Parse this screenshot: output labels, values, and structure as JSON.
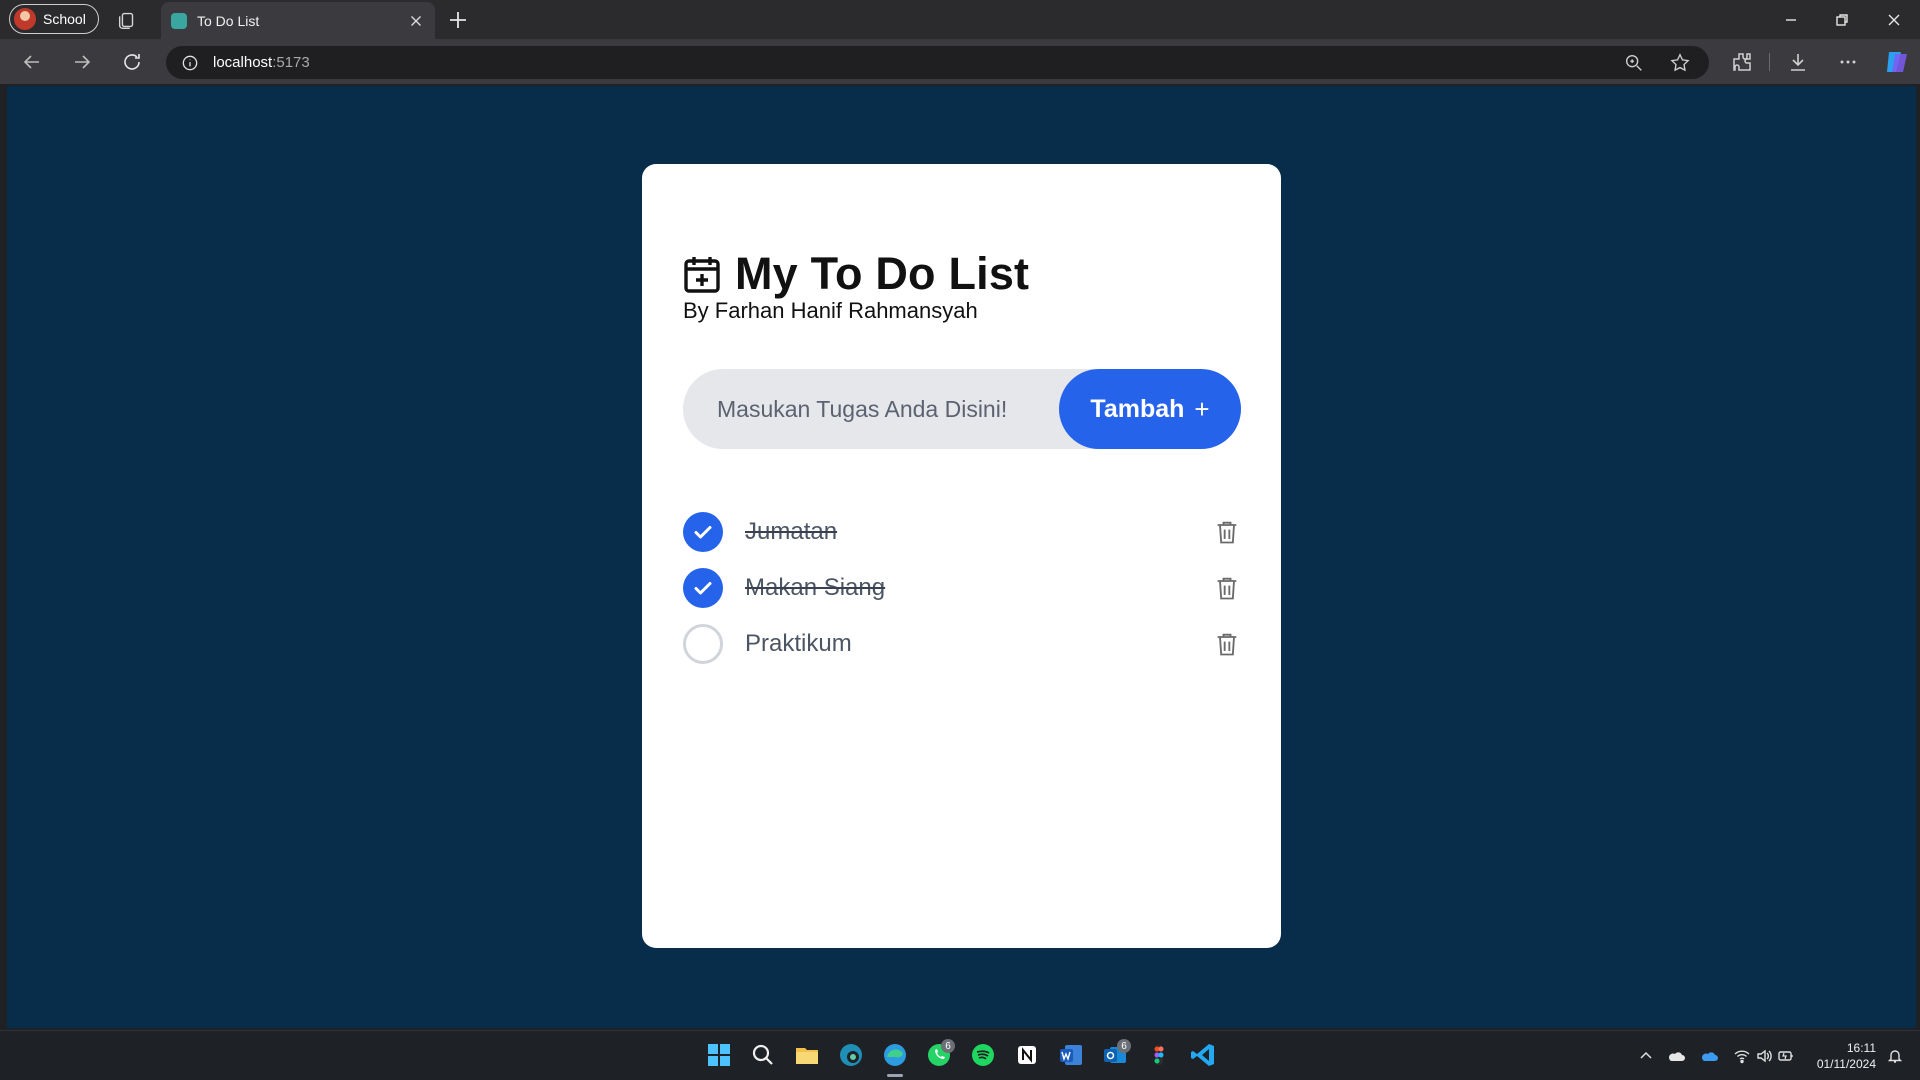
{
  "browser": {
    "profile_label": "School",
    "tab_title": "To Do List",
    "url_host": "localhost",
    "url_port": ":5173"
  },
  "app": {
    "title": "My To Do List",
    "subtitle": "By Farhan Hanif Rahmansyah",
    "input_placeholder": "Masukan Tugas Anda Disini!",
    "add_button_label": "Tambah",
    "add_button_icon": "+",
    "todos": [
      {
        "text": "Jumatan",
        "done": true
      },
      {
        "text": "Makan Siang",
        "done": true
      },
      {
        "text": "Praktikum",
        "done": false
      }
    ]
  },
  "colors": {
    "page_background": "#082d4b",
    "accent": "#2563eb",
    "input_background": "#e5e7eb"
  },
  "taskbar": {
    "whatsapp_badge": "6",
    "outlook_badge": "6",
    "time": "16:11",
    "date": "01/11/2024"
  }
}
